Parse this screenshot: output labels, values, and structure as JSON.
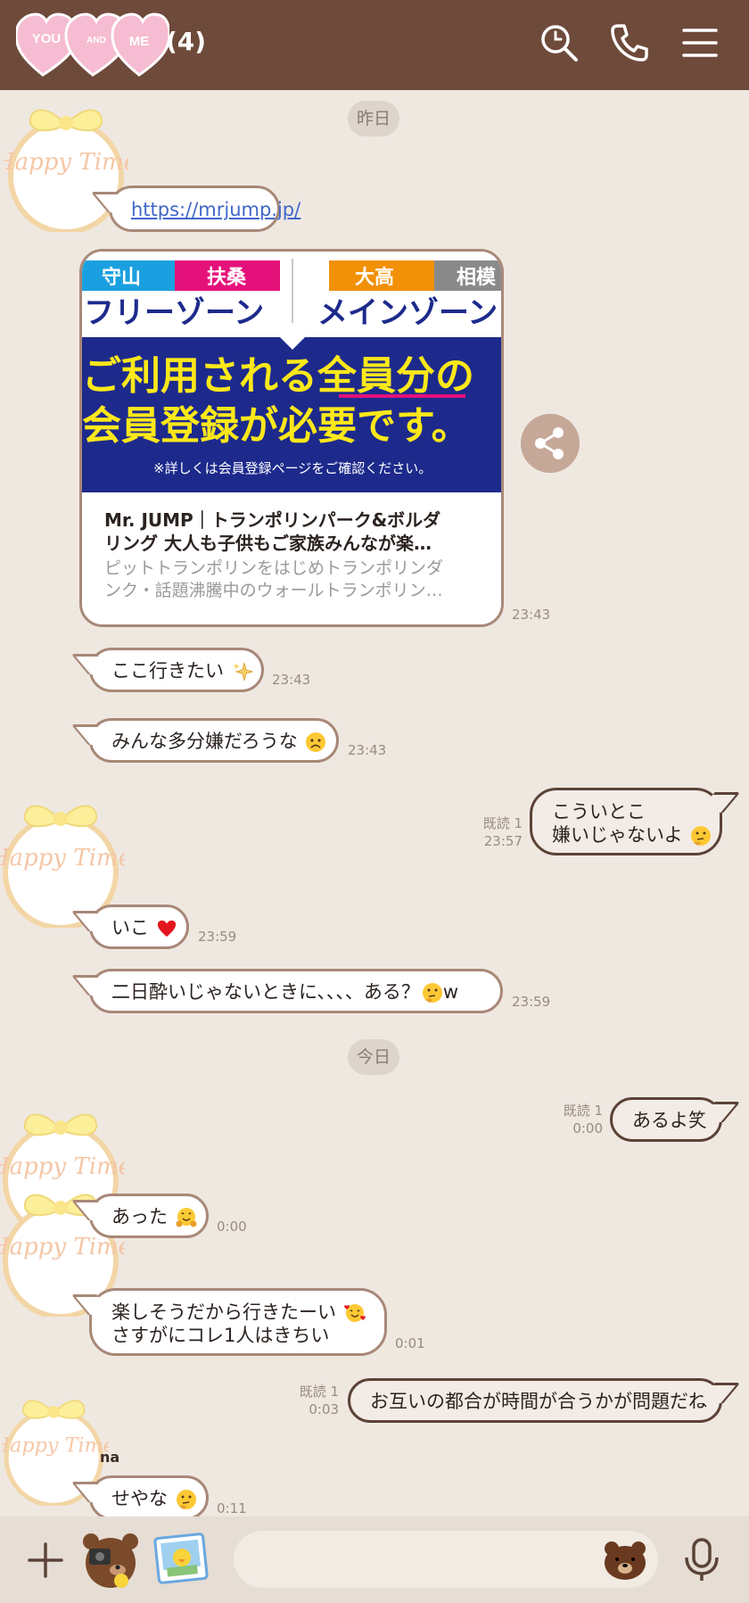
{
  "header": {
    "count": "(4)",
    "hearts": [
      "YOU",
      "AND",
      "ME"
    ]
  },
  "avatar_text": "Happy Time",
  "dates": {
    "yesterday": "昨日",
    "today": "今日"
  },
  "sender_partial": "na",
  "card": {
    "url": "https://mrjump.jp/",
    "banner": {
      "tags": [
        "守山",
        "扶桑",
        "大高",
        "相模"
      ],
      "zones": [
        "フリーゾーン",
        "メインゾーン"
      ],
      "line1": "ご利用される全員分の",
      "line2": "会員登録が必要です。",
      "note": "※詳しくは会員登録ページをご確認ください。"
    },
    "title": "Mr. JUMP｜トランポリンパーク&ボルダ\nリング 大人も子供もご家族みんなが楽…",
    "desc": "ピットトランポリンをはじめトランポリンダ\nンク・話題沸騰中のウォールトランポリン…",
    "time": "23:43"
  },
  "messages": {
    "m1": {
      "text": "ここ行きたい",
      "time": "23:43",
      "emoji": "sparkle-icon"
    },
    "m2": {
      "text": "みんな多分嫌だろうな",
      "time": "23:43",
      "emoji": "worried-face-icon"
    },
    "m3": {
      "line1": "こういとこ",
      "line2": "嫌いじゃないよ",
      "time": "23:57",
      "read": "既読 1",
      "emoji": "thinking-face-icon"
    },
    "m4": {
      "text": "いこ",
      "time": "23:59",
      "emoji": "red-heart-icon"
    },
    "m5": {
      "text": "二日酔いじゃないときに、、、、ある？",
      "suffix": "w",
      "time": "23:59",
      "emoji": "thinking-face-icon"
    },
    "m6": {
      "text": "あるよ笑",
      "time": "0:00",
      "read": "既読 1"
    },
    "m7": {
      "text": "あった",
      "time": "0:00",
      "emoji": "hugging-face-icon"
    },
    "m8": {
      "line1": "楽しそうだから行きたーい",
      "line2": "さすがにコレ1人はきちい",
      "time": "0:01",
      "emoji": "smiling-hearts-face-icon"
    },
    "m9": {
      "text": "お互いの都合が時間が合うかが問題だね",
      "time": "0:03",
      "read": "既読 1"
    },
    "m10": {
      "text": "せやな",
      "time": "0:11",
      "emoji": "thinking-face-icon"
    }
  },
  "input": {
    "placeholder": ""
  },
  "colors": {
    "header": "#6e4a3b",
    "background": "#efe8e1",
    "bubble_border": "#a88878"
  }
}
